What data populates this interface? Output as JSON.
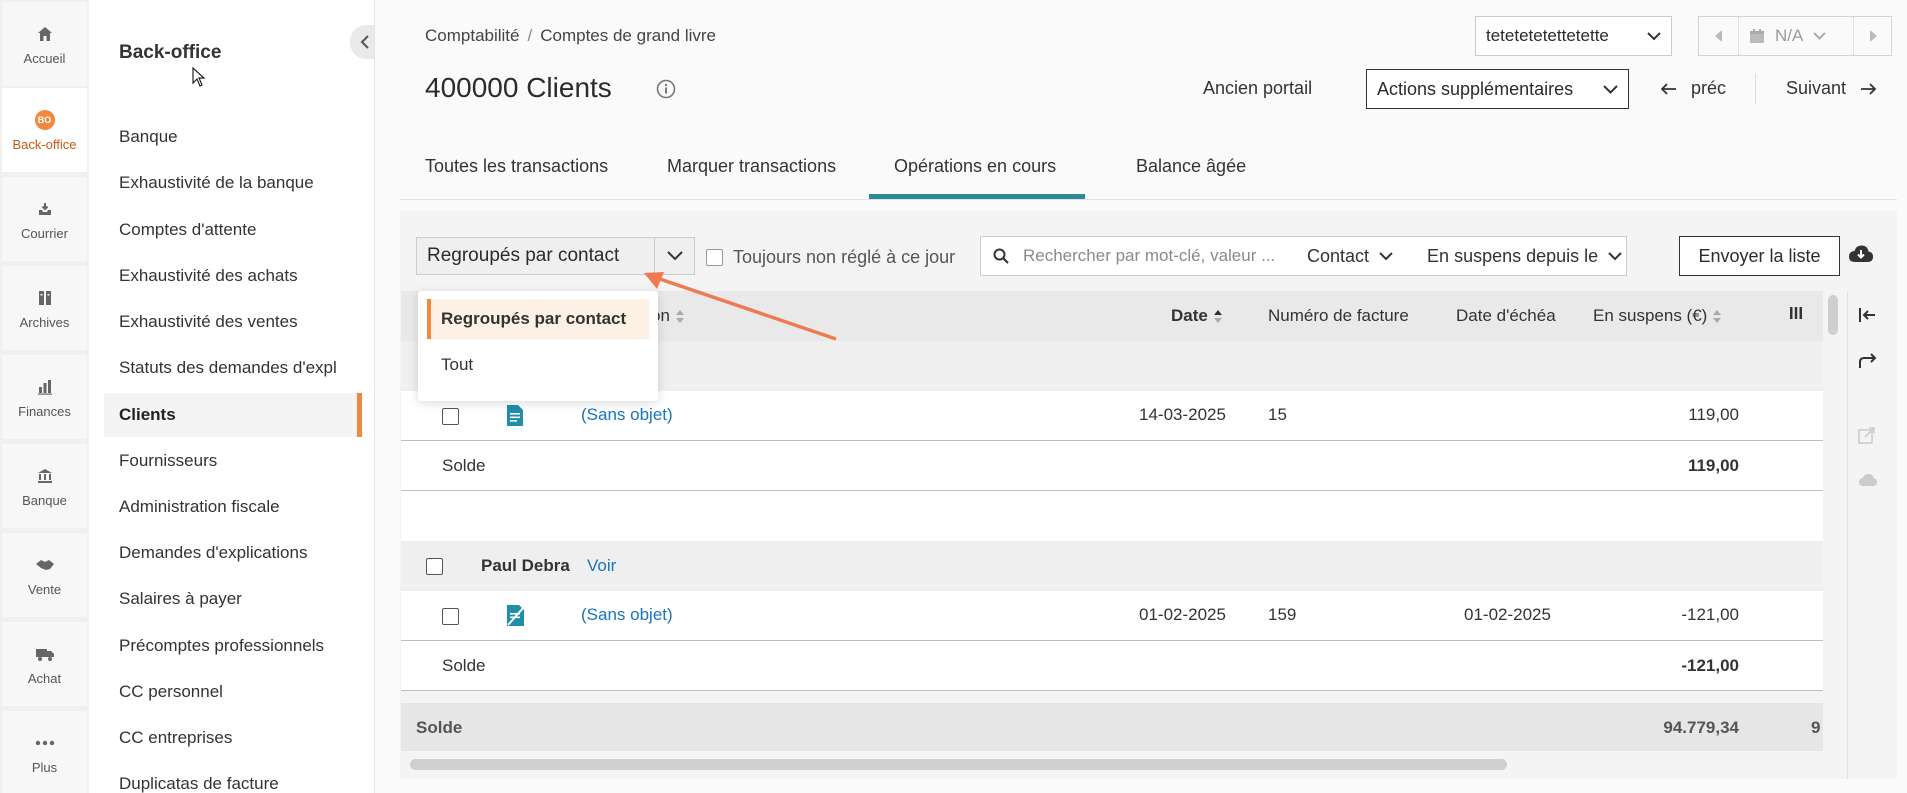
{
  "rail": {
    "items": [
      {
        "label": "Accueil",
        "icon": "home-icon"
      },
      {
        "label": "Back-office",
        "icon": "bo-badge-icon",
        "badge": "BO"
      },
      {
        "label": "Courrier",
        "icon": "inbox-icon"
      },
      {
        "label": "Archives",
        "icon": "archive-icon"
      },
      {
        "label": "Finances",
        "icon": "bar-chart-icon"
      },
      {
        "label": "Banque",
        "icon": "bank-icon"
      },
      {
        "label": "Vente",
        "icon": "handshake-icon"
      },
      {
        "label": "Achat",
        "icon": "truck-icon"
      },
      {
        "label": "Plus",
        "icon": "more-dots-icon"
      }
    ]
  },
  "sidebar": {
    "title": "Back-office",
    "items": [
      {
        "label": "Banque"
      },
      {
        "label": "Exhaustivité de la banque"
      },
      {
        "label": "Comptes d'attente"
      },
      {
        "label": "Exhaustivité des achats"
      },
      {
        "label": "Exhaustivité des ventes"
      },
      {
        "label": "Statuts des demandes d'expl"
      },
      {
        "label": "Clients"
      },
      {
        "label": "Fournisseurs"
      },
      {
        "label": "Administration fiscale"
      },
      {
        "label": "Demandes d'explications"
      },
      {
        "label": "Salaires à payer"
      },
      {
        "label": "Précomptes professionnels"
      },
      {
        "label": "CC personnel"
      },
      {
        "label": "CC entreprises"
      },
      {
        "label": "Duplicatas de facture"
      }
    ]
  },
  "header": {
    "breadcrumb": [
      "Comptabilité",
      "Comptes de grand livre"
    ],
    "breadcrumb_sep": "/",
    "title": "400000 Clients",
    "company": "tetetetetettetette",
    "period": "N/A",
    "old_portal": "Ancien portail",
    "more_actions": "Actions supplémentaires",
    "prev": "préc",
    "next": "Suivant"
  },
  "tabs": [
    {
      "label": "Toutes les transactions"
    },
    {
      "label": "Marquer transactions"
    },
    {
      "label": "Opérations en cours",
      "active": true
    },
    {
      "label": "Balance âgée"
    }
  ],
  "toolbar": {
    "group_select": "Regroupés par contact",
    "always_unsettled": "Toujours non réglé à ce jour",
    "search_placeholder": "Rechercher par mot-clé, valeur ...",
    "contact_filter": "Contact",
    "pending_filter": "En suspens depuis le",
    "send_list": "Envoyer la liste"
  },
  "dropdown": {
    "options": [
      "Regroupés par contact",
      "Tout"
    ],
    "selected": "Regroupés par contact"
  },
  "table": {
    "columns": {
      "description_partial": "on",
      "date": "Date",
      "invoice": "Numéro de facture",
      "due": "Date d'échéa",
      "pending": "En suspens (€)"
    },
    "group1": {
      "row": {
        "description": "(Sans objet)",
        "date": "14-03-2025",
        "invoice": "15",
        "due": "",
        "amount": "119,00"
      },
      "balance_label": "Solde",
      "balance": "119,00"
    },
    "group2": {
      "contact": "Paul Debra",
      "view": "Voir",
      "row": {
        "description": "(Sans objet)",
        "date": "01-02-2025",
        "invoice": "159",
        "due": "01-02-2025",
        "amount": "-121,00"
      },
      "balance_label": "Solde",
      "balance": "-121,00"
    },
    "total": {
      "label": "Solde",
      "value": "94.779,34",
      "overflow": "9"
    }
  },
  "colors": {
    "accent": "#f0883e",
    "tab_underline": "#2a8b95",
    "link": "#1a74bf",
    "doc_icon": "#1f8fa8"
  }
}
